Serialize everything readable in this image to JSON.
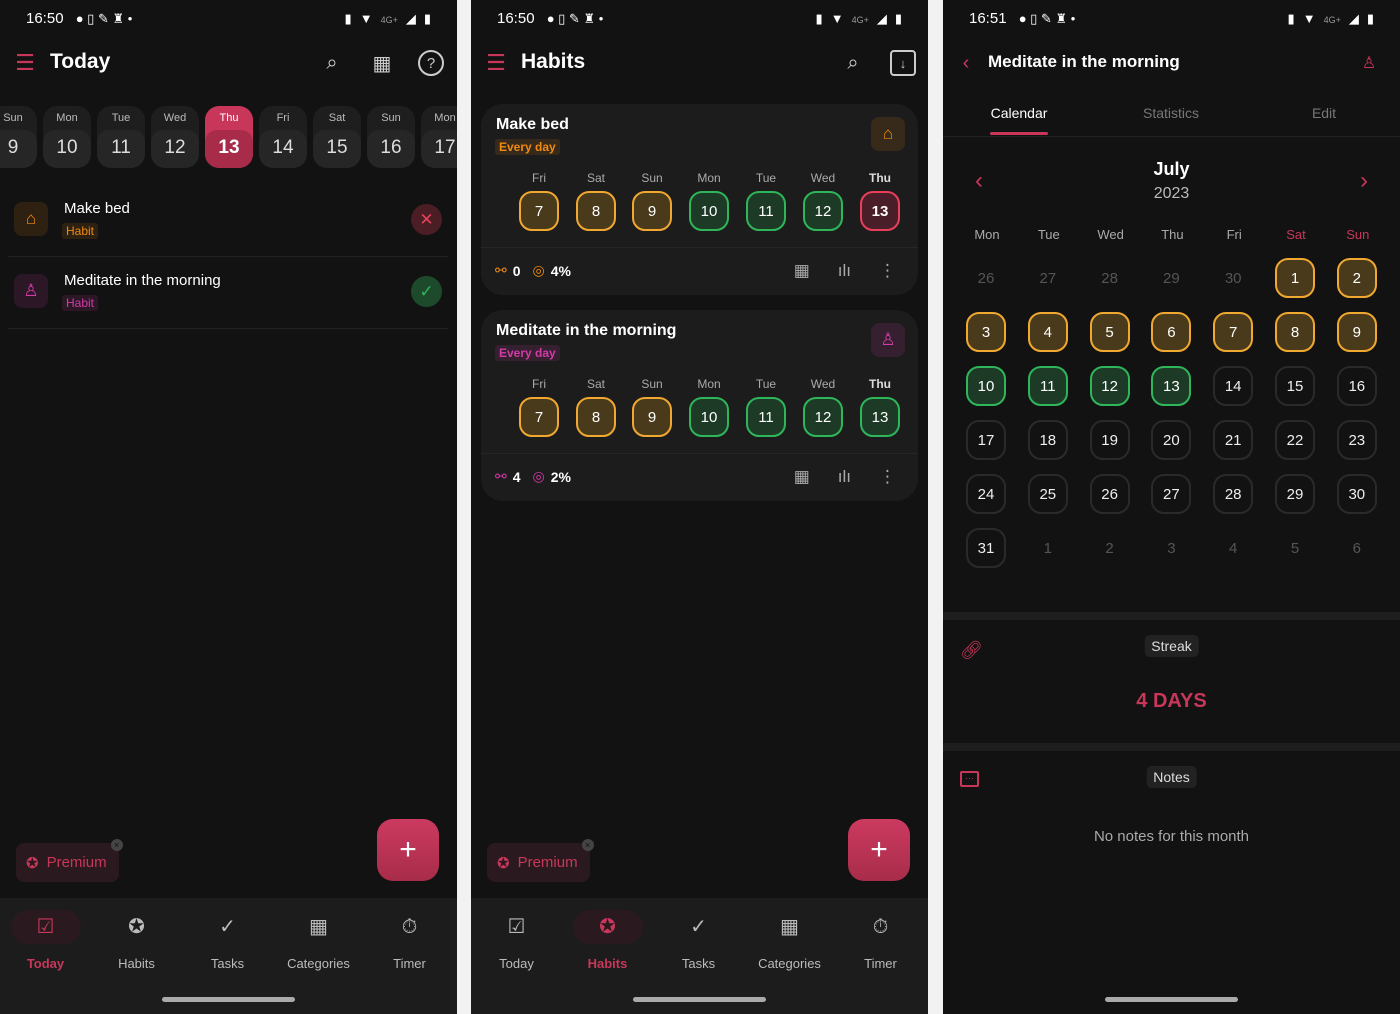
{
  "colors": {
    "accent": "#c8375a",
    "skipped": "#f0a830",
    "done": "#2fb55a",
    "failed": "#e8405a"
  },
  "today_screen": {
    "status": {
      "time": "16:50",
      "network": "4G+"
    },
    "title": "Today",
    "header_icons": [
      "search-icon",
      "calendar-icon",
      "help-icon"
    ],
    "days": [
      {
        "name": "Sun",
        "num": "9"
      },
      {
        "name": "Mon",
        "num": "10"
      },
      {
        "name": "Tue",
        "num": "11"
      },
      {
        "name": "Wed",
        "num": "12"
      },
      {
        "name": "Thu",
        "num": "13",
        "selected": true
      },
      {
        "name": "Fri",
        "num": "14"
      },
      {
        "name": "Sat",
        "num": "15"
      },
      {
        "name": "Sun",
        "num": "16"
      },
      {
        "name": "Mon",
        "num": "17"
      }
    ],
    "items": [
      {
        "title": "Make bed",
        "tag": "Habit",
        "icon": "home-icon",
        "color": "#f08a10",
        "status": "failed"
      },
      {
        "title": "Meditate in the morning",
        "tag": "Habit",
        "icon": "meditation-icon",
        "color": "#d43aa8",
        "status": "done"
      }
    ],
    "premium": "Premium",
    "nav": [
      {
        "label": "Today",
        "active": true
      },
      {
        "label": "Habits"
      },
      {
        "label": "Tasks"
      },
      {
        "label": "Categories"
      },
      {
        "label": "Timer"
      }
    ]
  },
  "habits_screen": {
    "status": {
      "time": "16:50",
      "network": "4G+"
    },
    "title": "Habits",
    "header_icons": [
      "search-icon",
      "archive-icon"
    ],
    "cards": [
      {
        "title": "Make bed",
        "frequency": "Every day",
        "icon": "home-icon",
        "color": "#f08a10",
        "streak": "0",
        "rate": "4%",
        "days": [
          {
            "name": "Fri",
            "num": "7",
            "state": "skip"
          },
          {
            "name": "Sat",
            "num": "8",
            "state": "skip"
          },
          {
            "name": "Sun",
            "num": "9",
            "state": "skip"
          },
          {
            "name": "Mon",
            "num": "10",
            "state": "done"
          },
          {
            "name": "Tue",
            "num": "11",
            "state": "done"
          },
          {
            "name": "Wed",
            "num": "12",
            "state": "done"
          },
          {
            "name": "Thu",
            "num": "13",
            "state": "fail"
          }
        ]
      },
      {
        "title": "Meditate in the morning",
        "frequency": "Every day",
        "icon": "meditation-icon",
        "color": "#d43aa8",
        "streak": "4",
        "rate": "2%",
        "days": [
          {
            "name": "Fri",
            "num": "7",
            "state": "skip"
          },
          {
            "name": "Sat",
            "num": "8",
            "state": "skip"
          },
          {
            "name": "Sun",
            "num": "9",
            "state": "skip"
          },
          {
            "name": "Mon",
            "num": "10",
            "state": "done"
          },
          {
            "name": "Tue",
            "num": "11",
            "state": "done"
          },
          {
            "name": "Wed",
            "num": "12",
            "state": "done"
          },
          {
            "name": "Thu",
            "num": "13",
            "state": "done"
          }
        ]
      }
    ],
    "premium": "Premium",
    "nav": [
      {
        "label": "Today"
      },
      {
        "label": "Habits",
        "active": true
      },
      {
        "label": "Tasks"
      },
      {
        "label": "Categories"
      },
      {
        "label": "Timer"
      }
    ]
  },
  "detail_screen": {
    "status": {
      "time": "16:51",
      "network": "4G+"
    },
    "title": "Meditate in the morning",
    "tabs": [
      {
        "label": "Calendar",
        "active": true
      },
      {
        "label": "Statistics"
      },
      {
        "label": "Edit"
      }
    ],
    "month": "July",
    "year": "2023",
    "weekdays": [
      "Mon",
      "Tue",
      "Wed",
      "Thu",
      "Fri",
      "Sat",
      "Sun"
    ],
    "calendar": [
      {
        "num": "26",
        "state": "dim"
      },
      {
        "num": "27",
        "state": "dim"
      },
      {
        "num": "28",
        "state": "dim"
      },
      {
        "num": "29",
        "state": "dim"
      },
      {
        "num": "30",
        "state": "dim"
      },
      {
        "num": "1",
        "state": "skip"
      },
      {
        "num": "2",
        "state": "skip"
      },
      {
        "num": "3",
        "state": "skip"
      },
      {
        "num": "4",
        "state": "skip"
      },
      {
        "num": "5",
        "state": "skip"
      },
      {
        "num": "6",
        "state": "skip"
      },
      {
        "num": "7",
        "state": "skip"
      },
      {
        "num": "8",
        "state": "skip"
      },
      {
        "num": "9",
        "state": "skip"
      },
      {
        "num": "10",
        "state": "done"
      },
      {
        "num": "11",
        "state": "done"
      },
      {
        "num": "12",
        "state": "done"
      },
      {
        "num": "13",
        "state": "done"
      },
      {
        "num": "14",
        "state": "none"
      },
      {
        "num": "15",
        "state": "none"
      },
      {
        "num": "16",
        "state": "none"
      },
      {
        "num": "17",
        "state": "none"
      },
      {
        "num": "18",
        "state": "none"
      },
      {
        "num": "19",
        "state": "none"
      },
      {
        "num": "20",
        "state": "none"
      },
      {
        "num": "21",
        "state": "none"
      },
      {
        "num": "22",
        "state": "none"
      },
      {
        "num": "23",
        "state": "none"
      },
      {
        "num": "24",
        "state": "none"
      },
      {
        "num": "25",
        "state": "none"
      },
      {
        "num": "26",
        "state": "none"
      },
      {
        "num": "27",
        "state": "none"
      },
      {
        "num": "28",
        "state": "none"
      },
      {
        "num": "29",
        "state": "none"
      },
      {
        "num": "30",
        "state": "none"
      },
      {
        "num": "31",
        "state": "none"
      },
      {
        "num": "1",
        "state": "dim"
      },
      {
        "num": "2",
        "state": "dim"
      },
      {
        "num": "3",
        "state": "dim"
      },
      {
        "num": "4",
        "state": "dim"
      },
      {
        "num": "5",
        "state": "dim"
      },
      {
        "num": "6",
        "state": "dim"
      }
    ],
    "streak_label": "Streak",
    "streak_value": "4 DAYS",
    "notes_label": "Notes",
    "notes_empty": "No notes for this month"
  }
}
